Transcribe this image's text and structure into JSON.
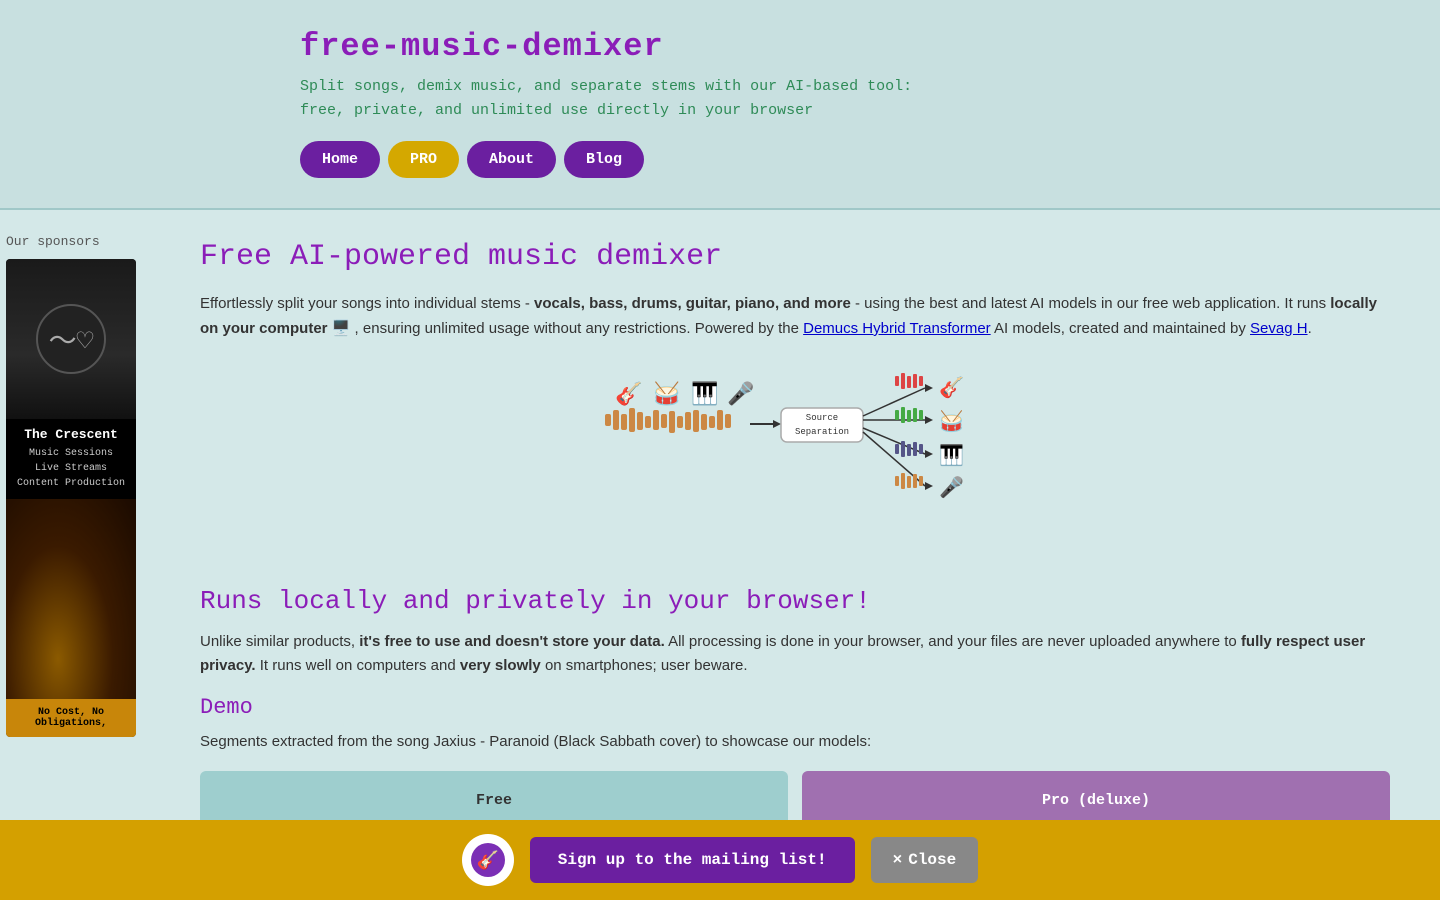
{
  "header": {
    "title": "free-music-demixer",
    "subtitle_line1": "Split songs, demix music, and separate stems with our AI-based tool:",
    "subtitle_line2": "free, private, and unlimited use directly in your browser",
    "nav": {
      "home_label": "Home",
      "pro_label": "PRO",
      "about_label": "About",
      "blog_label": "Blog"
    }
  },
  "sidebar": {
    "sponsors_label": "Our sponsors",
    "sponsor": {
      "name": "The Crescent",
      "desc_line1": "Music Sessions",
      "desc_line2": "Live Streams",
      "desc_line3": "Content Production"
    },
    "sponsor_bottom": {
      "line1": "No Cost, No",
      "line2": "Obligations,"
    }
  },
  "main": {
    "title": "Free AI-powered music demixer",
    "intro": "Effortlessly split your songs into individual stems -",
    "intro_bold": "vocals, bass, drums, guitar, piano, and more",
    "intro_rest": "- using the best and latest AI models in our free web application. It runs",
    "locally_bold": "locally on your computer",
    "locally_emoji": "🖥️",
    "locally_rest": ", ensuring unlimited usage without any restrictions. Powered by the",
    "dht_link": "Demucs Hybrid Transformer",
    "dht_rest": "AI models, created and maintained by",
    "sevag_link": "Sevag H",
    "sevag_rest": ".",
    "section2_title": "Runs locally and privately in your browser!",
    "para2_start": "Unlike similar products,",
    "para2_bold": "it's free to use and doesn't store your data.",
    "para2_rest": "All processing is done in your browser, and your files are never uploaded anywhere to",
    "para2_bold2": "fully respect user privacy.",
    "para2_rest2": "It runs well on computers and",
    "para2_bold3": "very slowly",
    "para2_rest3": "on smartphones; user beware.",
    "demo_title": "Demo",
    "demo_para": "Segments extracted from the song Jaxius - Paranoid (Black Sabbath cover) to showcase our models:",
    "demo_col_free": "Free",
    "demo_col_pro": "Pro (deluxe)"
  },
  "mailing_bar": {
    "signup_label": "Sign up to the mailing list!",
    "close_label": "Close",
    "close_icon": "×"
  }
}
